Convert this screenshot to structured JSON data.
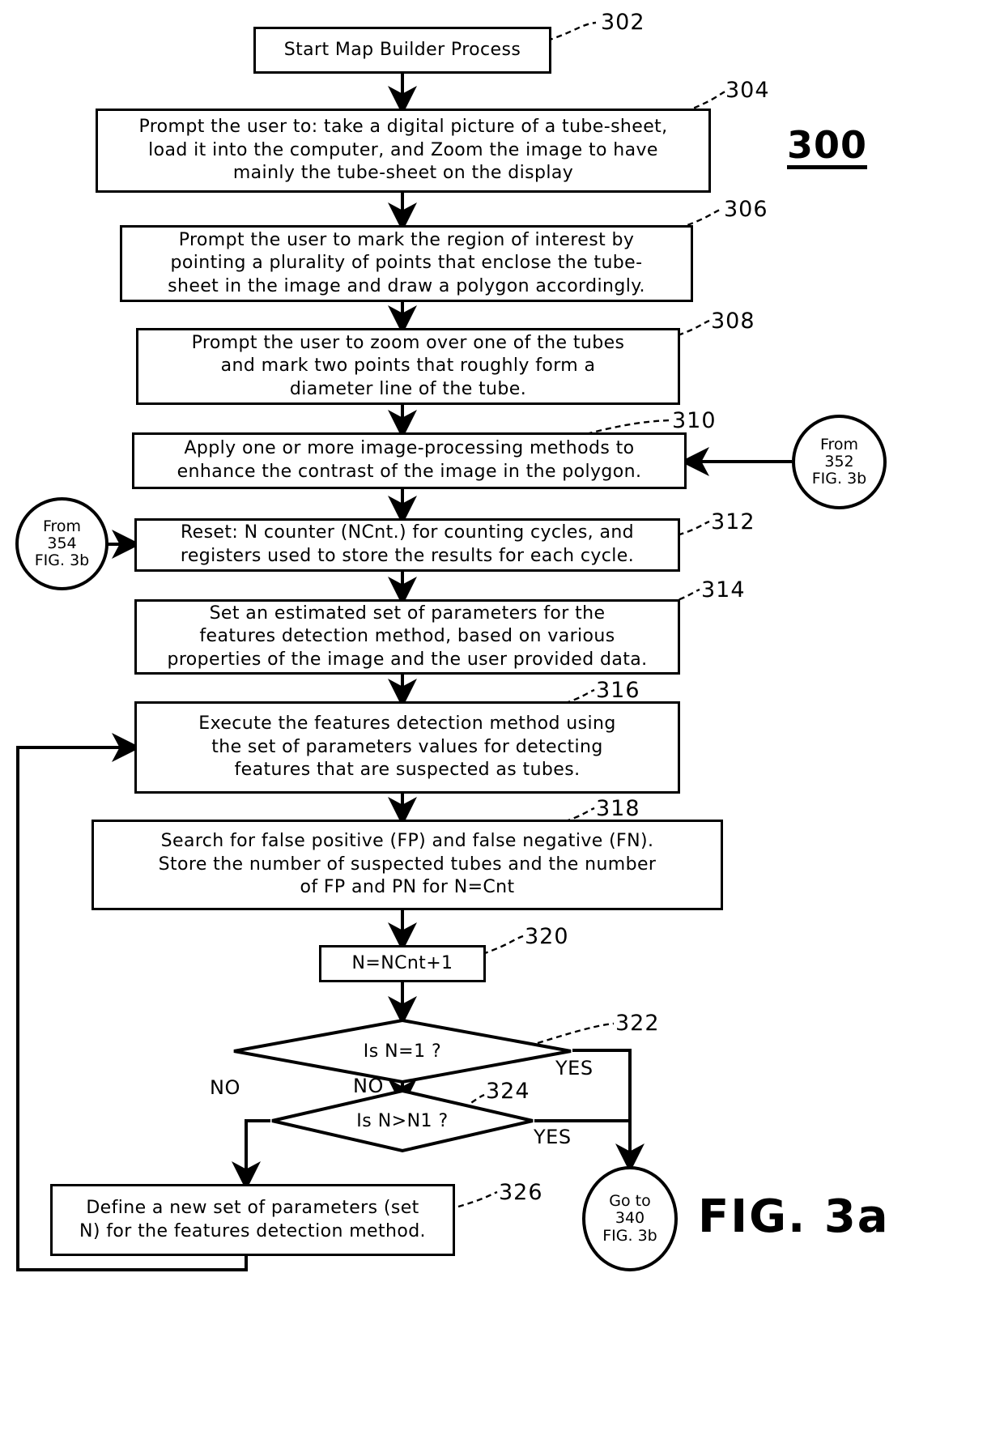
{
  "figure": {
    "number_label": "300",
    "title": "FIG. 3a"
  },
  "nodes": [
    {
      "id": "302",
      "ref": "302",
      "type": "process",
      "text": "Start Map Builder Process"
    },
    {
      "id": "304",
      "ref": "304",
      "type": "process",
      "text": "Prompt the user to: take a digital picture of a tube-sheet,\nload it into the computer, and Zoom the image to have\nmainly the tube-sheet on the display"
    },
    {
      "id": "306",
      "ref": "306",
      "type": "process",
      "text": "Prompt the user to mark the region of interest by\npointing a plurality of points that enclose the tube-\nsheet in the image and draw a polygon accordingly."
    },
    {
      "id": "308",
      "ref": "308",
      "type": "process",
      "text": "Prompt the user to zoom over one of the tubes\nand mark two points that roughly form a\ndiameter line of the tube."
    },
    {
      "id": "310",
      "ref": "310",
      "type": "process",
      "text": "Apply one or more image-processing methods to\nenhance the contrast of the image in the polygon."
    },
    {
      "id": "312",
      "ref": "312",
      "type": "process",
      "text": "Reset: N counter (NCnt.) for counting cycles, and\nregisters used to store the results for each cycle."
    },
    {
      "id": "314",
      "ref": "314",
      "type": "process",
      "text": "Set an estimated set of parameters for the\nfeatures detection method, based on various\nproperties of the image and the user provided data."
    },
    {
      "id": "316",
      "ref": "316",
      "type": "process",
      "text": "Execute the features detection method using\nthe set of parameters values for detecting\nfeatures that are suspected as tubes."
    },
    {
      "id": "318",
      "ref": "318",
      "type": "process",
      "text": "Search for false positive (FP) and false negative (FN).\nStore the number of suspected tubes and the number\nof FP and PN for N=Cnt"
    },
    {
      "id": "320",
      "ref": "320",
      "type": "process",
      "text": "N=NCnt+1"
    },
    {
      "id": "322",
      "ref": "322",
      "type": "decision",
      "text": "Is N=1 ?"
    },
    {
      "id": "324",
      "ref": "324",
      "type": "decision",
      "text": "Is N>N1 ?"
    },
    {
      "id": "326",
      "ref": "326",
      "type": "process",
      "text": "Define a new set of parameters (set\nN) for the features detection method."
    }
  ],
  "connectors": [
    {
      "id": "from-352",
      "text": "From\n352\nFIG. 3b"
    },
    {
      "id": "from-354",
      "text": "From\n354\nFIG. 3b"
    },
    {
      "id": "go-to-340",
      "text": "Go to\n340\nFIG. 3b"
    }
  ],
  "edge_labels": {
    "yes_322": "YES",
    "no_322": "NO",
    "yes_324": "YES",
    "no_324": "NO"
  },
  "refs": {
    "r302": "302",
    "r304": "304",
    "r306": "306",
    "r308": "308",
    "r310": "310",
    "r312": "312",
    "r314": "314",
    "r316": "316",
    "r318": "318",
    "r320": "320",
    "r322": "322",
    "r324": "324",
    "r326": "326"
  }
}
